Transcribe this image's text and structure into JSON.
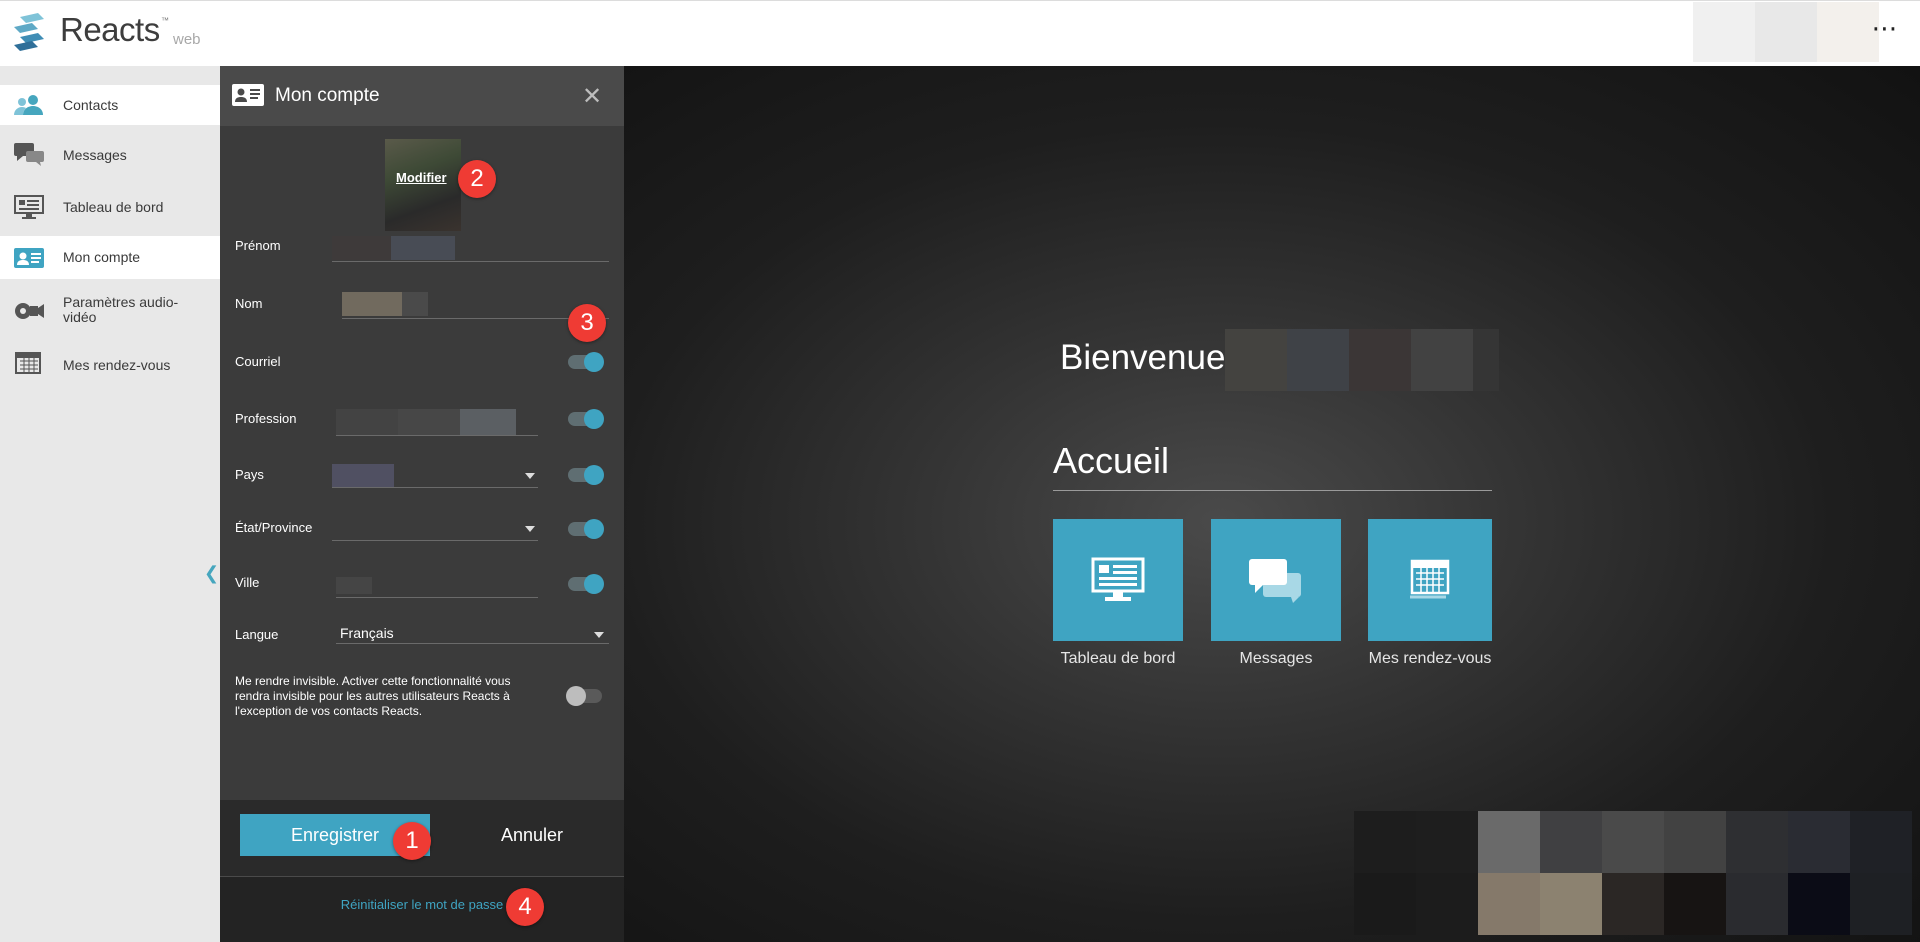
{
  "app": {
    "name": "Reacts",
    "tm": "™",
    "suffix": "web",
    "more": "⋯"
  },
  "sidebar": {
    "items": [
      {
        "label": "Contacts",
        "icon": "contacts-icon",
        "active": true
      },
      {
        "label": "Messages",
        "icon": "messages-icon",
        "active": false
      },
      {
        "label": "Tableau de bord",
        "icon": "dashboard-icon",
        "active": false
      },
      {
        "label": "Mon compte",
        "icon": "account-card-icon",
        "active": true
      },
      {
        "label": "Paramètres audio-vidéo",
        "icon": "audio-video-settings-icon",
        "active": false
      },
      {
        "label": "Mes rendez-vous",
        "icon": "calendar-icon",
        "active": false
      }
    ],
    "collapse": "❮"
  },
  "account_panel": {
    "title": "Mon compte",
    "close": "✕",
    "modify_photo": "Modifier",
    "fields": {
      "first_name": {
        "label": "Prénom"
      },
      "last_name": {
        "label": "Nom"
      },
      "email": {
        "label": "Courriel",
        "visible": true
      },
      "profession": {
        "label": "Profession",
        "visible": true
      },
      "country": {
        "label": "Pays",
        "visible": true
      },
      "state": {
        "label": "État/Province",
        "visible": true
      },
      "city": {
        "label": "Ville",
        "visible": true
      },
      "language": {
        "label": "Langue",
        "value": "Français"
      }
    },
    "invisible_mode": {
      "text": "Me rendre invisible. Activer cette fonctionnalité vous rendra invisible pour les autres utilisateurs Reacts à l'exception de vos contacts Reacts.",
      "enabled": false
    },
    "save_label": "Enregistrer",
    "cancel_label": "Annuler",
    "reset_password": "Réinitialiser le mot de passe"
  },
  "annotations": {
    "save": "1",
    "modify": "2",
    "toggles": "3",
    "reset": "4"
  },
  "home": {
    "welcome": "Bienvenue",
    "title": "Accueil",
    "tiles": [
      {
        "label": "Tableau de bord",
        "icon": "dashboard-icon"
      },
      {
        "label": "Messages",
        "icon": "messages-icon"
      },
      {
        "label": "Mes rendez-vous",
        "icon": "calendar-icon"
      }
    ]
  },
  "colors": {
    "accent": "#3fa4c2",
    "badge": "#ef3b34",
    "panel": "#3b3b3b"
  }
}
